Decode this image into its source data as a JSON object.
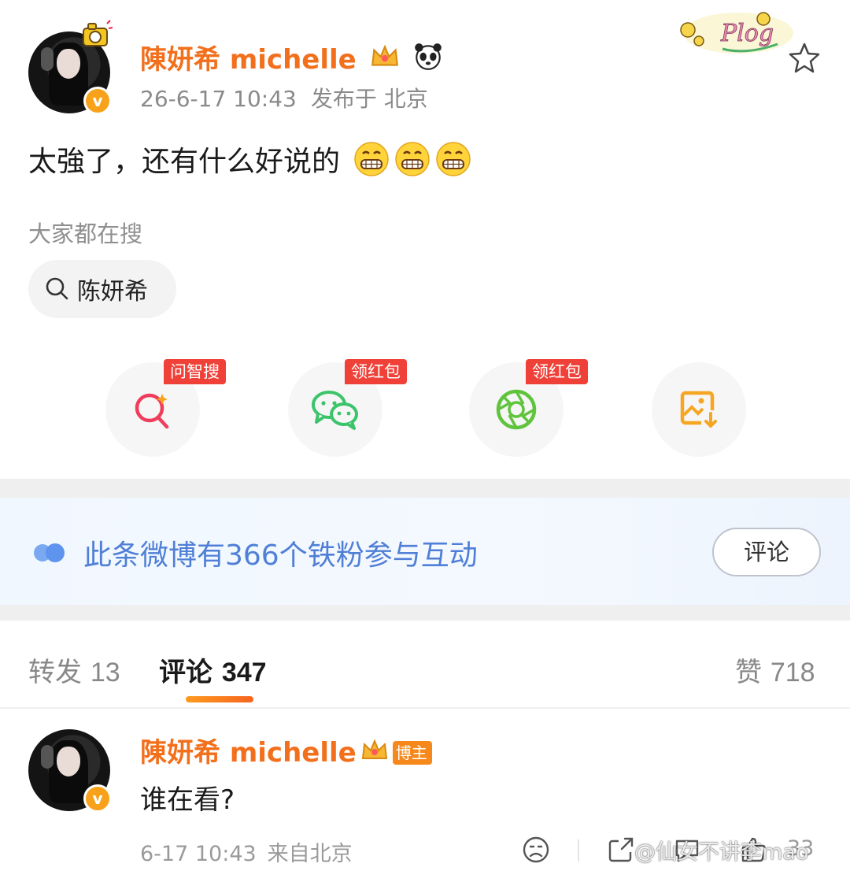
{
  "post": {
    "username": "陳妍希 michelle",
    "time": "26-6-17 10:43",
    "location": "发布于 北京",
    "text": "太強了，还有什么好说的",
    "search_label": "大家都在搜",
    "search_chip": "陈妍希"
  },
  "share": {
    "items": [
      {
        "tag": "问智搜",
        "icon": "ai-search-icon",
        "color": "#ef3e5c"
      },
      {
        "tag": "领红包",
        "icon": "wechat-icon",
        "color": "#3cc46b"
      },
      {
        "tag": "领红包",
        "icon": "moments-icon",
        "color": "#5fc43c"
      },
      {
        "tag": "",
        "icon": "save-image-icon",
        "color": "#f5a623"
      }
    ]
  },
  "fans": {
    "text": "此条微博有366个铁粉参与互动",
    "button": "评论"
  },
  "tabs": {
    "repost_label": "转发",
    "repost_count": "13",
    "comment_label": "评论",
    "comment_count": "347",
    "like_label": "赞",
    "like_count": "718"
  },
  "comment": {
    "username": "陳妍希 michelle",
    "role_badge": "博主",
    "text": "谁在看?",
    "time": "6-17 10:43",
    "location": "来自北京",
    "like_count": "33"
  },
  "watermark": "@仙女不讲李mao",
  "colors": {
    "username": "#f26f1c",
    "fan_text": "#4f7fd6",
    "tag_red": "#f04139",
    "tab_underline": "#f5651f"
  }
}
